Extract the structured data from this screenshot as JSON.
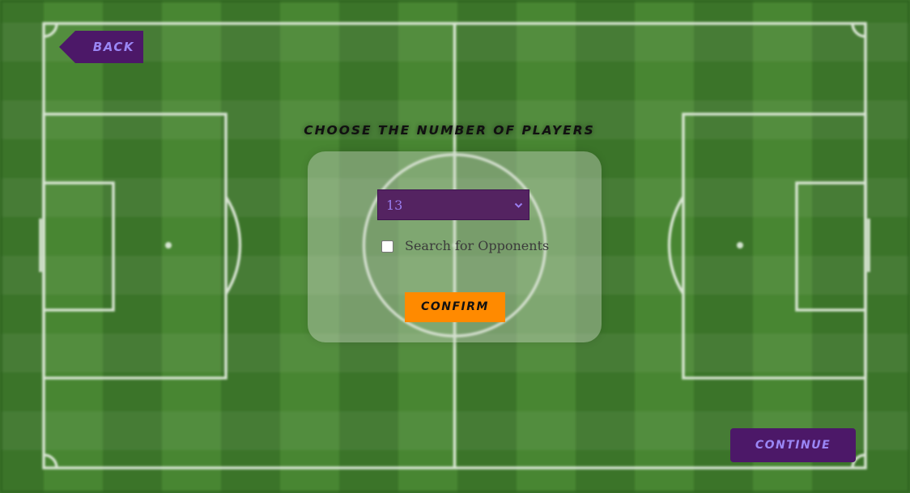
{
  "nav": {
    "back_label": "BACK",
    "continue_label": "CONTINUE"
  },
  "setup": {
    "heading": "CHOOSE THE NUMBER OF PLAYERS",
    "player_count_selected": "13",
    "search_opponents_label": "Search for Opponents",
    "search_opponents_checked": false,
    "confirm_label": "CONFIRM"
  },
  "colors": {
    "pitch_green": "#3f7a2c",
    "stripe_light": "#4a8a33",
    "line_white": "#e6efe2",
    "accent_purple": "#4c1868",
    "accent_purple_text": "#9a86f5",
    "confirm_orange": "#ff8a00"
  }
}
